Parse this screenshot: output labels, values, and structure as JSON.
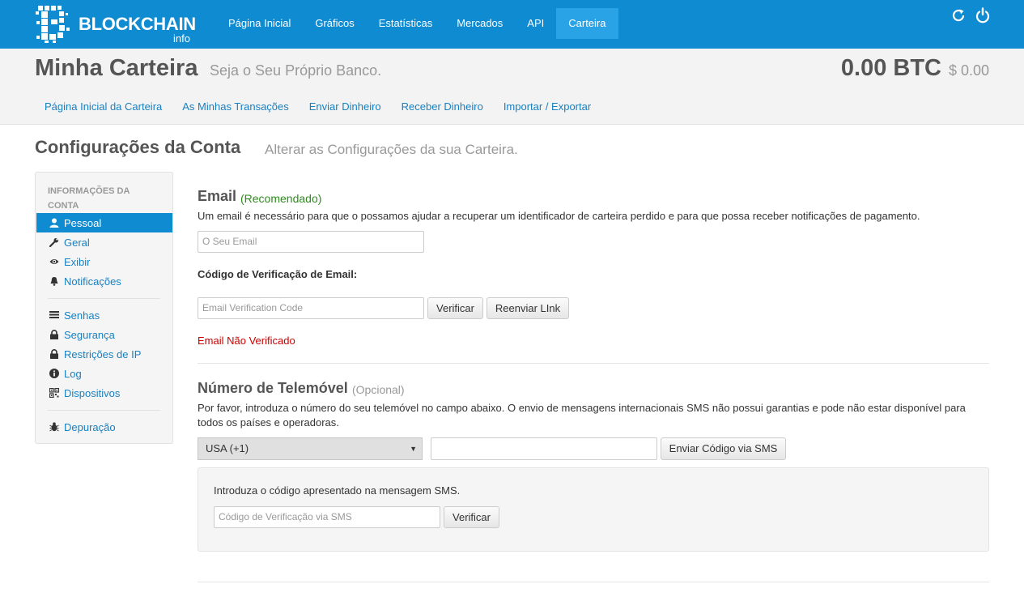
{
  "topbar": {
    "logo_text": "BLOCKCHAIN",
    "logo_sub": "info",
    "nav": [
      {
        "label": "Página Inicial"
      },
      {
        "label": "Gráficos"
      },
      {
        "label": "Estatísticas"
      },
      {
        "label": "Mercados"
      },
      {
        "label": "API"
      },
      {
        "label": "Carteira",
        "active": true
      }
    ],
    "accent": "#0f8bd1"
  },
  "header": {
    "title": "Minha Carteira",
    "subtitle": "Seja o Seu Próprio Banco.",
    "balance_btc": "0.00 BTC",
    "balance_fiat": "$ 0.00",
    "subnav": [
      {
        "label": "Página Inicial da Carteira"
      },
      {
        "label": "As Minhas Transações"
      },
      {
        "label": "Enviar Dinheiro"
      },
      {
        "label": "Receber Dinheiro"
      },
      {
        "label": "Importar / Exportar"
      }
    ]
  },
  "section": {
    "title": "Configurações da Conta",
    "subtitle": "Alterar as Configurações da sua Carteira."
  },
  "sidebar": {
    "heading": "INFORMAÇÕES DA CONTA",
    "items": [
      {
        "label": "Pessoal",
        "icon": "user-icon",
        "active": true
      },
      {
        "label": "Geral",
        "icon": "wrench-icon"
      },
      {
        "label": "Exibir",
        "icon": "eye-icon"
      },
      {
        "label": "Notificações",
        "icon": "bell-icon"
      },
      {
        "label": "Senhas",
        "icon": "list-icon"
      },
      {
        "label": "Segurança",
        "icon": "lock-icon"
      },
      {
        "label": "Restrições de IP",
        "icon": "lock-icon"
      },
      {
        "label": "Log",
        "icon": "info-icon"
      },
      {
        "label": "Dispositivos",
        "icon": "qrcode-icon"
      },
      {
        "label": "Depuração",
        "icon": "bug-icon"
      }
    ]
  },
  "email": {
    "heading": "Email",
    "tag": "(Recomendado)",
    "description": "Um email é necessário para que o possamos ajudar a recuperar um identificador de carteira perdido e para que possa receber notificações de pagamento.",
    "placeholder": "O Seu Email",
    "verification_label": "Código de Verificação de Email:",
    "verification_placeholder": "Email Verification Code",
    "verify_button": "Verificar",
    "resend_button": "Reenviar LInk",
    "status": "Email Não Verificado"
  },
  "phone": {
    "heading": "Número de Telemóvel",
    "tag": "(Opcional)",
    "description_line1": "Por favor, introduza o número do seu telemóvel no campo abaixo. O envio de mensagens internacionais SMS não possui garantias e pode não estar disponível para",
    "description_line2": "todos os países e operadoras.",
    "country": "USA (+1)",
    "send_button": "Enviar Código via SMS",
    "sms_prompt": "Introduza o código apresentado na mensagem SMS.",
    "sms_placeholder": "Código de Verificação via SMS",
    "sms_verify_button": "Verificar"
  }
}
